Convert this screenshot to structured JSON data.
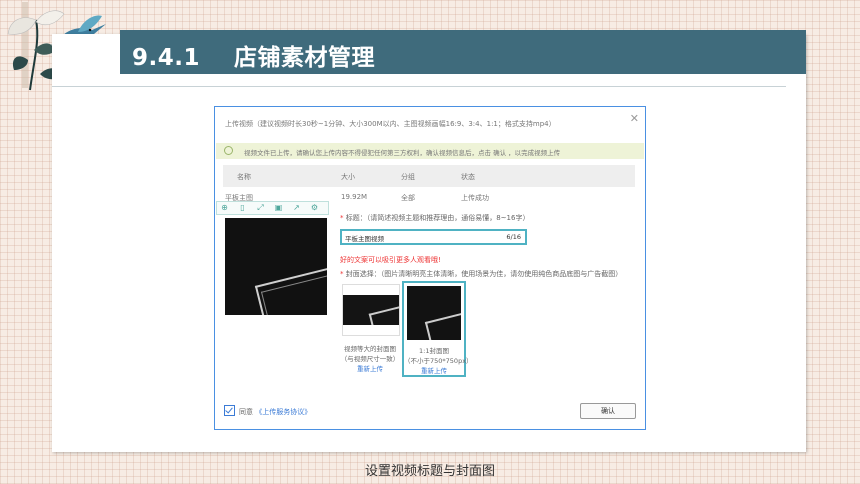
{
  "slide": {
    "section_number": "9.4.1",
    "section_title": "店铺素材管理",
    "caption": "设置视频标题与封面图",
    "header_color": "#3f6b7c"
  },
  "dialog": {
    "title": "上传视频（建议视频时长30秒~1分钟、大小300M以内、主图视频画幅16:9、3:4、1:1；格式支持mp4）",
    "close_icon": "close-icon",
    "notice": "视频文件已上传，请确认您上传内容不得侵犯任何第三方权利，确认视频信息后，点击 确认 ，以完成视频上传",
    "table": {
      "headers": [
        "名称",
        "大小",
        "分组",
        "状态"
      ],
      "row": [
        "平板主图",
        "19.92M",
        "全部",
        "上传成功"
      ]
    },
    "title_field": {
      "label": "标题：（请简述视频主题和推荐理由，通俗易懂，8~16字）",
      "value": "平板主图视频",
      "count": "6/16"
    },
    "tip": "好的文案可以吸引更多人观看哦!",
    "cover": {
      "label": "封面选择：（图片清晰明亮主体清晰，使用场景为佳，请勿使用纯色商品底图与广告截图）",
      "option1": {
        "line1": "视频等大的封面图",
        "line2": "（与视频尺寸一致）",
        "reupload": "重新上传"
      },
      "option2": {
        "line1": "1:1封面图",
        "line2": "（不小于750*750px）",
        "reupload": "重新上传"
      }
    },
    "agree_text": "同意",
    "agree_link": "《上传服务协议》",
    "confirm": "确认"
  },
  "viewer_toolbar": [
    "zoom-icon",
    "book-icon",
    "fullscreen-icon",
    "save-icon",
    "share-icon",
    "settings-icon"
  ]
}
